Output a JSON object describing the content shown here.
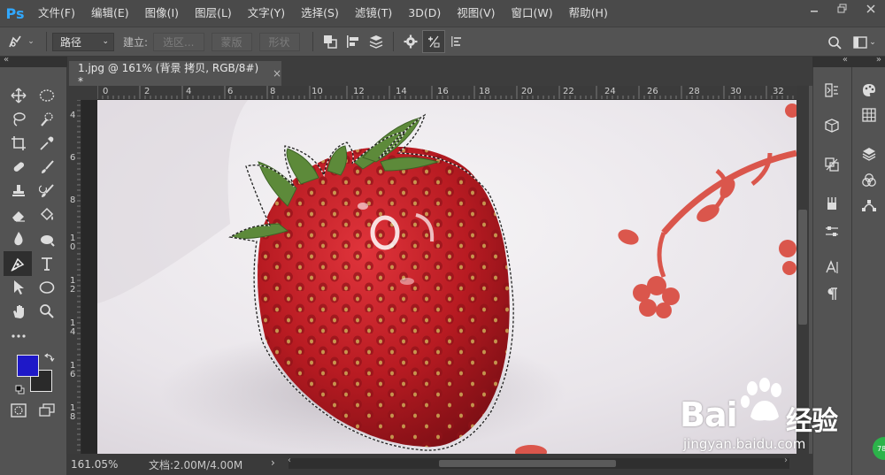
{
  "app": {
    "logo": "Ps"
  },
  "menu": {
    "items": [
      "文件(F)",
      "编辑(E)",
      "图像(I)",
      "图层(L)",
      "文字(Y)",
      "选择(S)",
      "滤镜(T)",
      "3D(D)",
      "视图(V)",
      "窗口(W)",
      "帮助(H)"
    ]
  },
  "options": {
    "mode_select": "路径",
    "make_label": "建立:",
    "selection_btn": "选区...",
    "mask_btn": "蒙版",
    "shape_btn": "形状"
  },
  "panel_collapse": {
    "left": "«",
    "right": "«",
    "far_right": "»"
  },
  "document": {
    "tab_title": "1.jpg @ 161% (背景 拷贝, RGB/8#) *",
    "close": "×"
  },
  "ruler_h": [
    "0",
    "2",
    "4",
    "6",
    "8",
    "10",
    "12",
    "14",
    "16",
    "18",
    "20",
    "22",
    "24",
    "26",
    "28",
    "30",
    "32"
  ],
  "ruler_v": [
    "4",
    "6",
    "8",
    "1\n0",
    "1\n2",
    "1\n4",
    "1\n6",
    "1\n8"
  ],
  "status": {
    "zoom": "161.05%",
    "doc_info": "文档:2.00M/4.00M",
    "arrow": "›"
  },
  "watermark": {
    "brand": "Bai",
    "brand2": "经验",
    "url": "jingyan.baidu.com"
  },
  "badge": {
    "text": "78"
  },
  "colors": {
    "foreground": "#1e18c8",
    "background": "#2a2a2a",
    "ps_blue": "#31a8ff"
  }
}
